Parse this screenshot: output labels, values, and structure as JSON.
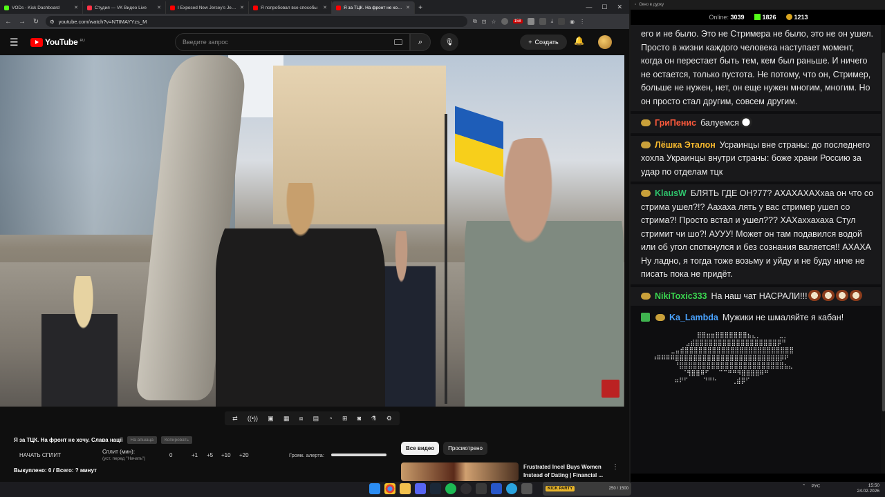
{
  "browser": {
    "tabs": [
      {
        "title": "VODs - Kick Dashboard",
        "color": "#53fc18"
      },
      {
        "title": "Студия — VK Видео Live",
        "color": "#ff3347"
      },
      {
        "title": "I Exposed New Jersey's Jewish",
        "color": "#ff0000"
      },
      {
        "title": "Я попробовал все способы",
        "color": "#ff0000"
      },
      {
        "title": "Я за ТЦК. На фронт не хочу. С",
        "color": "#ff0000",
        "active": true
      }
    ],
    "url": "youtube.com/watch?v=NTIMAYYzs_M",
    "ext_badge": "158"
  },
  "youtube": {
    "logo": "YouTube",
    "region": "RU",
    "search_placeholder": "Введите запрос",
    "create_label": "Создать"
  },
  "video": {
    "title": "Я за ТЦК. На фронт не хочу. Слава нації",
    "pill1": "На апшаца",
    "pill2": "Копировать"
  },
  "split": {
    "start_label": "НАЧАТЬ СПЛИТ",
    "minutes_label": "Сплит (мин):",
    "minutes_hint": "(уст. перед \"Начать\")",
    "value": "0",
    "plus1": "+1",
    "plus5": "+5",
    "plus10": "+10",
    "plus20": "+20",
    "alert_label": "Громк. алерта:",
    "bought": "Выкуплено: 0 / Всего: ? минут"
  },
  "chips": {
    "all": "Все видео",
    "watched": "Просмотрено"
  },
  "recommendation": {
    "title": "Frustrated Incel Buys Women Instead of Dating | Financial ..."
  },
  "chat": {
    "window_title": "Окно в дурку",
    "online_label": "Online:",
    "online": "3039",
    "followers": "1826",
    "points": "1213",
    "messages": [
      {
        "user": "",
        "color": "",
        "text": "его и не было. Это не Стримера не было, это не он ушел. Просто в жизни каждого человека наступает момент, когда он перестает быть тем, кем был раньше. И ничего не остается, только пустота. Не потому, что он, Стример, больше не нужен, нет, он еще нужен многим, многим. Но он просто стал другим, совсем другим."
      },
      {
        "user": "ГриПенис&#x2640;",
        "user_text": "ГриПенис",
        "color": "#ff5a3c",
        "text": "балуемся"
      },
      {
        "user_text": "Лёшка Эталон",
        "color": "#f5b82e",
        "text": "Усраинцы вне страны: до последнего хохла Украинцы внутри страны: боже храни Россию за удар по отделам тцк"
      },
      {
        "user_text": "KlausW",
        "color": "#2ec16b",
        "text": "БЛЯТЬ ГДЕ ОН?77? АХАХАХАХхаа он что со стрима ушел?!? Аахаха лять у вас стример ушел со стрима?! Просто встал и ушел??? ХАХаххахаха Стул стримит чи шо?! АУУУ! Может он там подавился водой или об угол споткнулся и без сознания валяется!! АХАХА Ну ладно, я тогда тоже возьму и уйду и не буду ниче не писать пока не придёт."
      },
      {
        "user_text": "NikiToxic333",
        "color": "#3ad64f",
        "text": "На наш чат НАСРАЛИ!!!"
      },
      {
        "user_text": "Ka_Lambda",
        "color": "#4aa3ff",
        "text": "Мужики не шмаляйте я кабан!"
      }
    ],
    "ascii_art": "            ⣿⣿⣶⣶⣿⣿⣿⣿⣿⣿⣿⣦⣄⡀⠀⠀⠀⠀⣀⡀\n         ⣠⣾⣿⣿⣿⣿⣿⣿⣿⣿⣿⣿⣿⣿⣿⣿⣿⣿⣿⣿⡿⠛\n     ⣀⣤⣾⣿⣿⣿⣿⣿⣿⣿⣿⣿⣿⣿⣿⣿⣿⣿⣿⣿⣿⣿⣿⣿⣿⣿⣿\n⠰⠿⠿⠿⠿⣿⣿⣿⣿⣿⣿⣿⣿⣿⣿⣿⣿⣿⣿⣿⣿⣿⣿⣿⣿⣿⣿⣿⡿⠟\n      ⠘⣿⣿⣿⣿⣿⣿⣿⣿⣿⣿⣿⣿⣿⣿⣿⣿⣿⣿⣿⣿⣿⣿⣿⣦⣄\n        ⠈⢻⣿⣿⠿⠋⠀⠀⠉⠉⠛⠛⠻⣿⣿⣿⣿⠿⠛\n      ⠶⠟⠋    ⠙⠛⠓    ⢀⣾⡿⠋"
  },
  "taskbar": {
    "kick_banner": "KICK PARTY",
    "kick_stats": "250 / 1500",
    "lang": "РУС",
    "time": "15:50",
    "date": "24.02.2026"
  }
}
